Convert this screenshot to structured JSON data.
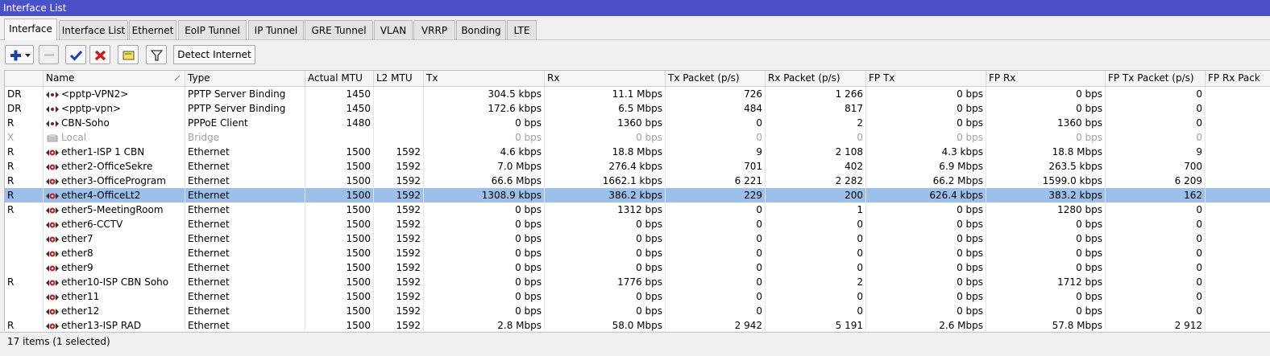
{
  "window": {
    "title": "Interface List"
  },
  "tabs": [
    {
      "label": "Interface",
      "active": true
    },
    {
      "label": "Interface List"
    },
    {
      "label": "Ethernet"
    },
    {
      "label": "EoIP Tunnel"
    },
    {
      "label": "IP Tunnel"
    },
    {
      "label": "GRE Tunnel"
    },
    {
      "label": "VLAN"
    },
    {
      "label": "VRRP"
    },
    {
      "label": "Bonding"
    },
    {
      "label": "LTE"
    }
  ],
  "toolbar": {
    "add_icon": "plus-icon",
    "remove_icon": "minus-icon",
    "enable_icon": "check-icon",
    "disable_icon": "x-icon",
    "comment_icon": "comment-icon",
    "filter_icon": "filter-icon",
    "detect_label": "Detect Internet"
  },
  "columns": [
    "",
    "Name",
    "Type",
    "Actual MTU",
    "L2 MTU",
    "Tx",
    "Rx",
    "Tx Packet (p/s)",
    "Rx Packet (p/s)",
    "FP Tx",
    "FP Rx",
    "FP Tx Packet (p/s)",
    "FP Rx Pack"
  ],
  "rows": [
    {
      "flag": "DR",
      "icon": "tunnel-icon",
      "name": "<pptp-VPN2>",
      "type": "PPTP Server Binding",
      "amtu": "1450",
      "l2mtu": "",
      "tx": "304.5 kbps",
      "rx": "11.1 Mbps",
      "txp": "726",
      "rxp": "1 266",
      "fptx": "0 bps",
      "fprx": "0 bps",
      "fptxp": "0"
    },
    {
      "flag": "DR",
      "icon": "tunnel-icon",
      "name": "<pptp-vpn>",
      "type": "PPTP Server Binding",
      "amtu": "1450",
      "l2mtu": "",
      "tx": "172.6 kbps",
      "rx": "6.5 Mbps",
      "txp": "484",
      "rxp": "817",
      "fptx": "0 bps",
      "fprx": "0 bps",
      "fptxp": "0"
    },
    {
      "flag": "R",
      "icon": "tunnel-icon",
      "name": "CBN-Soho",
      "type": "PPPoE Client",
      "amtu": "1480",
      "l2mtu": "",
      "tx": "0 bps",
      "rx": "1360 bps",
      "txp": "0",
      "rxp": "2",
      "fptx": "0 bps",
      "fprx": "1360 bps",
      "fptxp": "0"
    },
    {
      "flag": "X",
      "icon": "bridge-icon",
      "name": "Local",
      "type": "Bridge",
      "amtu": "",
      "l2mtu": "",
      "tx": "0 bps",
      "rx": "0 bps",
      "txp": "0",
      "rxp": "0",
      "fptx": "0 bps",
      "fprx": "0 bps",
      "fptxp": "0",
      "disabled": true
    },
    {
      "flag": "R",
      "icon": "ethernet-icon",
      "name": "ether1-ISP 1 CBN",
      "type": "Ethernet",
      "amtu": "1500",
      "l2mtu": "1592",
      "tx": "4.6 kbps",
      "rx": "18.8 Mbps",
      "txp": "9",
      "rxp": "2 108",
      "fptx": "4.3 kbps",
      "fprx": "18.8 Mbps",
      "fptxp": "9"
    },
    {
      "flag": "R",
      "icon": "ethernet-icon",
      "name": "ether2-OfficeSekre",
      "type": "Ethernet",
      "amtu": "1500",
      "l2mtu": "1592",
      "tx": "7.0 Mbps",
      "rx": "276.4 kbps",
      "txp": "701",
      "rxp": "402",
      "fptx": "6.9 Mbps",
      "fprx": "263.5 kbps",
      "fptxp": "700"
    },
    {
      "flag": "R",
      "icon": "ethernet-icon",
      "name": "ether3-OfficeProgram",
      "type": "Ethernet",
      "amtu": "1500",
      "l2mtu": "1592",
      "tx": "66.6 Mbps",
      "rx": "1662.1 kbps",
      "txp": "6 221",
      "rxp": "2 282",
      "fptx": "66.2 Mbps",
      "fprx": "1599.0 kbps",
      "fptxp": "6 209"
    },
    {
      "flag": "R",
      "icon": "ethernet-icon",
      "name": "ether4-OfficeLt2",
      "type": "Ethernet",
      "amtu": "1500",
      "l2mtu": "1592",
      "tx": "1308.9 kbps",
      "rx": "386.2 kbps",
      "txp": "229",
      "rxp": "200",
      "fptx": "626.4 kbps",
      "fprx": "383.2 kbps",
      "fptxp": "162",
      "selected": true
    },
    {
      "flag": "R",
      "icon": "ethernet-icon",
      "name": "ether5-MeetingRoom",
      "type": "Ethernet",
      "amtu": "1500",
      "l2mtu": "1592",
      "tx": "0 bps",
      "rx": "1312 bps",
      "txp": "0",
      "rxp": "1",
      "fptx": "0 bps",
      "fprx": "1280 bps",
      "fptxp": "0"
    },
    {
      "flag": "",
      "icon": "ethernet-icon",
      "name": "ether6-CCTV",
      "type": "Ethernet",
      "amtu": "1500",
      "l2mtu": "1592",
      "tx": "0 bps",
      "rx": "0 bps",
      "txp": "0",
      "rxp": "0",
      "fptx": "0 bps",
      "fprx": "0 bps",
      "fptxp": "0"
    },
    {
      "flag": "",
      "icon": "ethernet-icon",
      "name": "ether7",
      "type": "Ethernet",
      "amtu": "1500",
      "l2mtu": "1592",
      "tx": "0 bps",
      "rx": "0 bps",
      "txp": "0",
      "rxp": "0",
      "fptx": "0 bps",
      "fprx": "0 bps",
      "fptxp": "0"
    },
    {
      "flag": "",
      "icon": "ethernet-icon",
      "name": "ether8",
      "type": "Ethernet",
      "amtu": "1500",
      "l2mtu": "1592",
      "tx": "0 bps",
      "rx": "0 bps",
      "txp": "0",
      "rxp": "0",
      "fptx": "0 bps",
      "fprx": "0 bps",
      "fptxp": "0"
    },
    {
      "flag": "",
      "icon": "ethernet-icon",
      "name": "ether9",
      "type": "Ethernet",
      "amtu": "1500",
      "l2mtu": "1592",
      "tx": "0 bps",
      "rx": "0 bps",
      "txp": "0",
      "rxp": "0",
      "fptx": "0 bps",
      "fprx": "0 bps",
      "fptxp": "0"
    },
    {
      "flag": "R",
      "icon": "ethernet-icon",
      "name": "ether10-ISP CBN Soho",
      "type": "Ethernet",
      "amtu": "1500",
      "l2mtu": "1592",
      "tx": "0 bps",
      "rx": "1776 bps",
      "txp": "0",
      "rxp": "2",
      "fptx": "0 bps",
      "fprx": "1712 bps",
      "fptxp": "0"
    },
    {
      "flag": "",
      "icon": "ethernet-icon",
      "name": "ether11",
      "type": "Ethernet",
      "amtu": "1500",
      "l2mtu": "1592",
      "tx": "0 bps",
      "rx": "0 bps",
      "txp": "0",
      "rxp": "0",
      "fptx": "0 bps",
      "fprx": "0 bps",
      "fptxp": "0"
    },
    {
      "flag": "",
      "icon": "ethernet-icon",
      "name": "ether12",
      "type": "Ethernet",
      "amtu": "1500",
      "l2mtu": "1592",
      "tx": "0 bps",
      "rx": "0 bps",
      "txp": "0",
      "rxp": "0",
      "fptx": "0 bps",
      "fprx": "0 bps",
      "fptxp": "0"
    },
    {
      "flag": "R",
      "icon": "ethernet-icon",
      "name": "ether13-ISP RAD",
      "type": "Ethernet",
      "amtu": "1500",
      "l2mtu": "1592",
      "tx": "2.8 Mbps",
      "rx": "58.0 Mbps",
      "txp": "2 942",
      "rxp": "5 191",
      "fptx": "2.6 Mbps",
      "fprx": "57.8 Mbps",
      "fptxp": "2 912"
    }
  ],
  "status": {
    "text": "17 items (1 selected)"
  },
  "colors": {
    "titlebar": "#4a50c8",
    "selected_row": "#9cc0ea"
  }
}
